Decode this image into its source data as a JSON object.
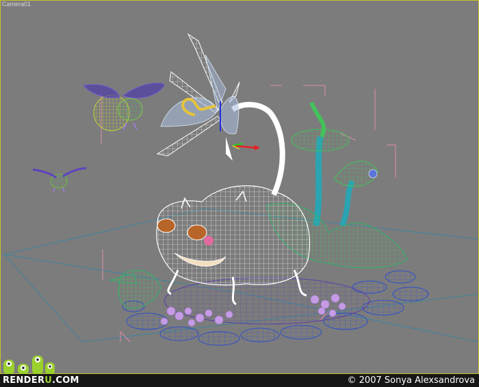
{
  "viewport": {
    "label": "Camera01",
    "background": "#7c7c7c",
    "frame_color": "#c9c12a"
  },
  "scene": {
    "objects": [
      {
        "name": "frog-creature",
        "render": "wireframe",
        "color": "#ffffff"
      },
      {
        "name": "flower-lamp",
        "render": "wireframe",
        "color": "#ffffff"
      },
      {
        "name": "bee-large",
        "render": "wireframe",
        "color": "#c4d23a"
      },
      {
        "name": "bee-small",
        "render": "wireframe",
        "color": "#6fbe3a"
      },
      {
        "name": "mushroom-left",
        "render": "wireframe",
        "color": "#4bbd5a"
      },
      {
        "name": "mushroom-right",
        "render": "wireframe",
        "color": "#4bbd5a"
      },
      {
        "name": "ground-pebbles",
        "render": "wireframe",
        "color": "#2d4fc9"
      },
      {
        "name": "flowers",
        "render": "wireframe",
        "color": "#c69be6"
      },
      {
        "name": "ground-plants",
        "render": "wireframe",
        "color": "#2fb36b"
      }
    ],
    "gizmo": {
      "x_color": "#e82020",
      "y_color": "#20d020",
      "z_color": "#2030e0"
    }
  },
  "footer": {
    "brand_prefix": "RENDER",
    "brand_accent": "U",
    "brand_suffix": ".COM",
    "copyright": "© 2007 Sonya Alexsandrova",
    "brand_color": "#9bd12e"
  }
}
